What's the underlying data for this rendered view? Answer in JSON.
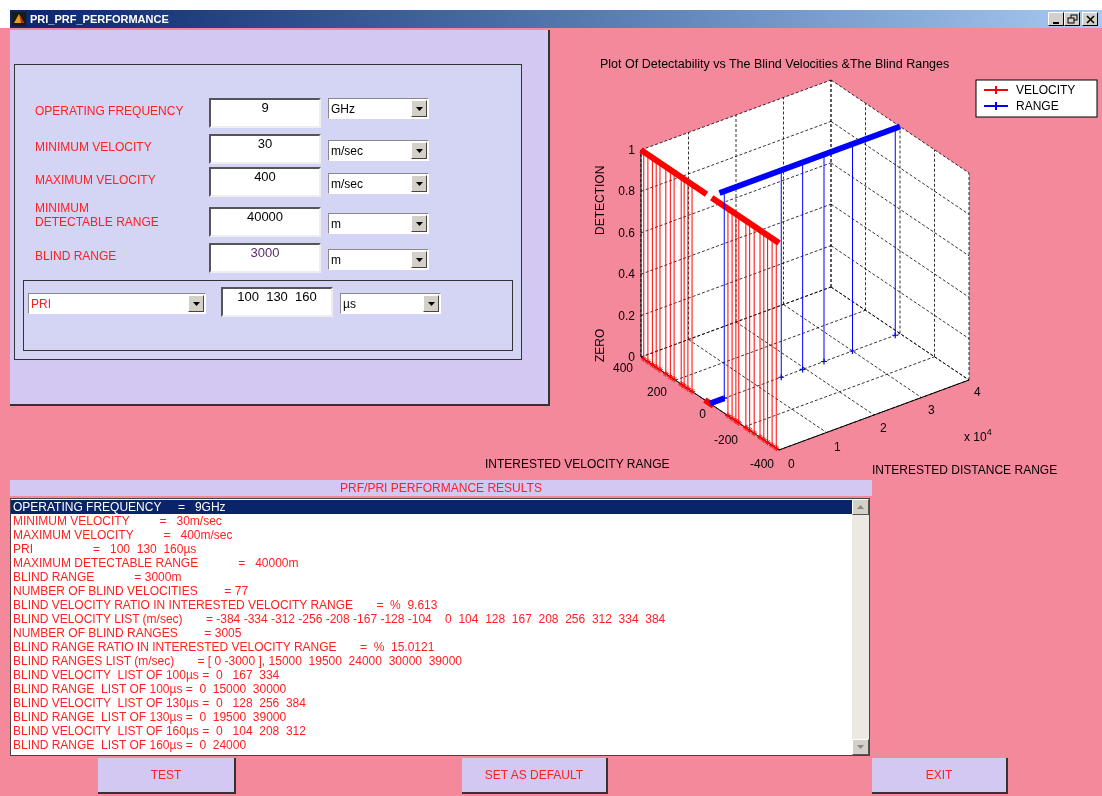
{
  "window": {
    "title": "PRI_PRF_PERFORMANCE"
  },
  "form": {
    "fields": [
      {
        "label": "OPERATING FREQUENCY",
        "value": "9",
        "unit": "GHz",
        "color": "#000000"
      },
      {
        "label": "MINIMUM VELOCITY",
        "value": "30",
        "unit": "m/sec",
        "color": "#000000"
      },
      {
        "label": "MAXIMUM VELOCITY",
        "value": "400",
        "unit": "m/sec",
        "color": "#000000"
      },
      {
        "label": "MINIMUM DETECTABLE RANGE",
        "value": "40000",
        "unit": "m",
        "color": "#000000"
      },
      {
        "label": "BLIND RANGE",
        "value": "3000",
        "unit": "m",
        "color": "#5a2a6e"
      }
    ],
    "mode": {
      "selection": "PRI",
      "values": "100  130  160",
      "unit": "µs"
    }
  },
  "chart": {
    "title": "Plot Of Detectability  vs The Blind Velocities &The Blind Ranges",
    "legend": [
      {
        "label": "VELOCITY",
        "color": "#ff0000"
      },
      {
        "label": "RANGE",
        "color": "#0000ff"
      }
    ],
    "z_labels": [
      "DETECTION",
      "ZERO"
    ],
    "z_ticks": [
      "1",
      "0.8",
      "0.6",
      "0.4",
      "0.2",
      "0"
    ],
    "velocity_ticks": [
      "400",
      "200",
      "0",
      "-200",
      "-400"
    ],
    "distance_ticks": [
      "0",
      "1",
      "2",
      "3",
      "4"
    ],
    "distance_multiplier": "x 10$^{4}$",
    "velocity_label": "INTERESTED VELOCITY RANGE",
    "distance_label": "INTERESTED DISTANCE RANGE"
  },
  "results": {
    "title": "PRF/PRI PERFORMANCE RESULTS",
    "lines": [
      {
        "text": "OPERATING FREQUENCY     =   9GHz",
        "selected": true
      },
      {
        "text": "MINIMUM VELOCITY         =   30m/sec",
        "selected": false
      },
      {
        "text": "MAXIMUM VELOCITY         =   400m/sec",
        "selected": false
      },
      {
        "text": "PRI                  =   100  130  160µs",
        "selected": false
      },
      {
        "text": "MAXIMUM DETECTABLE RANGE            =   40000m",
        "selected": false
      },
      {
        "text": "BLIND RANGE            = 3000m",
        "selected": false
      },
      {
        "text": "NUMBER OF BLIND VELOCITIES        = 77",
        "selected": false
      },
      {
        "text": "BLIND VELOCITY RATIO IN INTERESTED VELOCITY RANGE       =  %  9.613",
        "selected": false
      },
      {
        "text": "BLIND VELOCITY LIST (m/sec)       = -384 -334 -312 -256 -208 -167 -128 -104    0  104  128  167  208  256  312  334  384",
        "selected": false
      },
      {
        "text": "NUMBER OF BLIND RANGES        = 3005",
        "selected": false
      },
      {
        "text": "BLIND RANGE RATIO IN INTERESTED VELOCITY RANGE       =  %  15.0121",
        "selected": false
      },
      {
        "text": "BLIND RANGES LIST (m/sec)       = [ 0 -3000 ], 15000  19500  24000  30000  39000",
        "selected": false
      },
      {
        "text": "BLIND VELOCITY  LIST OF 100µs =  0   167  334",
        "selected": false
      },
      {
        "text": "BLIND RANGE  LIST OF 100µs =  0  15000  30000",
        "selected": false
      },
      {
        "text": "BLIND VELOCITY  LIST OF 130µs =  0   128  256  384",
        "selected": false
      },
      {
        "text": "BLIND RANGE  LIST OF 130µs =  0  19500  39000",
        "selected": false
      },
      {
        "text": "BLIND VELOCITY  LIST OF 160µs =  0   104  208  312",
        "selected": false
      },
      {
        "text": "BLIND RANGE  LIST OF 160µs =  0  24000",
        "selected": false
      }
    ]
  },
  "buttons": [
    "TEST",
    "SET AS DEFAULT",
    "EXIT"
  ]
}
